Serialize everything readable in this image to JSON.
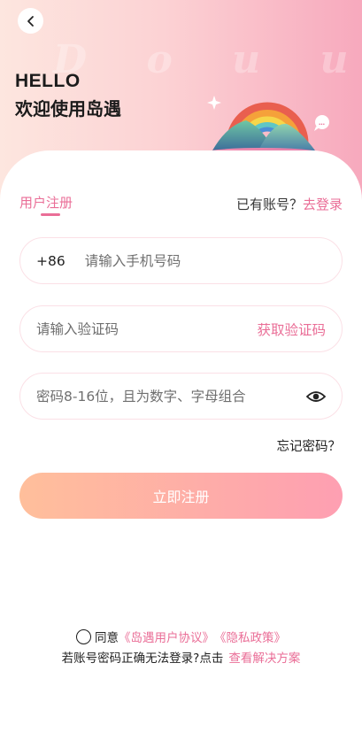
{
  "header": {
    "watermark": "D o u u",
    "greeting": "HELLO",
    "welcome": "欢迎使用岛遇"
  },
  "auth": {
    "tab_register": "用户注册",
    "have_account": "已有账号？",
    "login_link": "去登录"
  },
  "form": {
    "country_code": "+86",
    "phone_placeholder": "请输入手机号码",
    "code_placeholder": "请输入验证码",
    "get_code": "获取验证码",
    "password_placeholder": "密码8-16位，且为数字、字母组合",
    "forgot_password": "忘记密码？",
    "submit": "立即注册"
  },
  "footer": {
    "agree_prefix": "同意",
    "user_agreement": "《岛遇用户协议》",
    "privacy_policy": "《隐私政策》",
    "help_text": "若账号密码正确无法登录?点击",
    "help_link": "查看解决方案"
  },
  "icons": {
    "back": "chevron-left-icon",
    "eye": "eye-icon",
    "illustration": "rainbow-island-illustration"
  },
  "colors": {
    "accent": "#ea6e97",
    "button_start": "#ffbf9b",
    "button_end": "#fe9fb2",
    "hero_start": "#fde6df",
    "hero_end": "#f7a9bd"
  }
}
